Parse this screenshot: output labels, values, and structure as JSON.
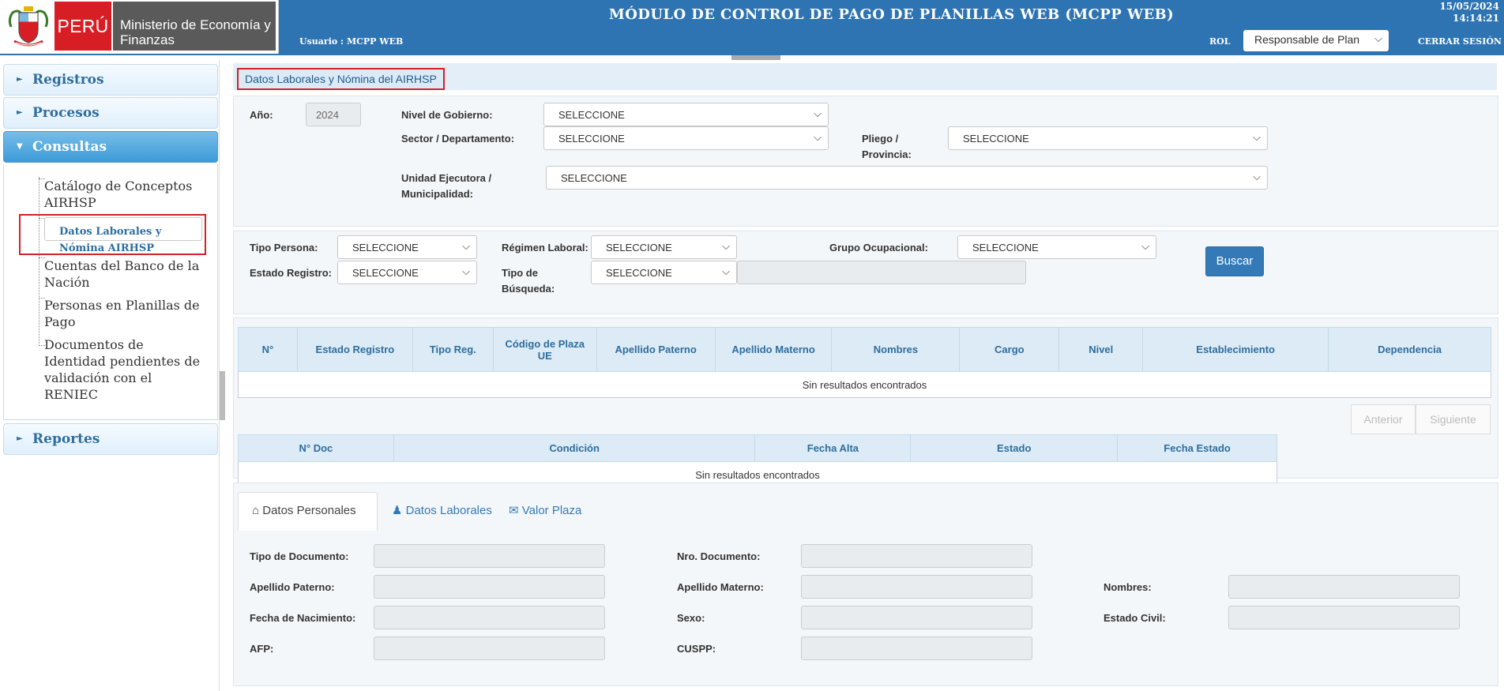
{
  "header": {
    "country": "PERÚ",
    "ministry": "Ministerio de Economía y Finanzas",
    "title": "MÓDULO DE CONTROL DE PAGO DE PLANILLAS WEB (MCPP WEB)",
    "date": "15/05/2024",
    "time": "14:14:21",
    "user_label": "Usuario : MCPP WEB",
    "rol_label": "ROL",
    "rol_value": "Responsable de Plan",
    "logout": "CERRAR SESIÓN"
  },
  "sidebar": {
    "sections": [
      {
        "label": "Registros"
      },
      {
        "label": "Procesos"
      },
      {
        "label": "Consultas"
      },
      {
        "label": "Reportes"
      }
    ],
    "consultas_items": [
      {
        "label": "Catálogo de Conceptos AIRHSP"
      },
      {
        "label": "Datos Laborales y Nómina AIRHSP"
      },
      {
        "label": "Cuentas del Banco de la Nación"
      },
      {
        "label": "Personas en Planillas de Pago"
      },
      {
        "label": "Documentos de Identidad pendientes de validación con el RENIEC"
      }
    ]
  },
  "page": {
    "title": "Datos Laborales y Nómina del AIRHSP"
  },
  "filters1": {
    "anio_label": "Año:",
    "anio_value": "2024",
    "nivel_label": "Nivel de Gobierno:",
    "nivel_value": "SELECCIONE",
    "sector_label": "Sector / Departamento:",
    "sector_value": "SELECCIONE",
    "pliego_label": "Pliego / Provincia:",
    "pliego_value": "SELECCIONE",
    "unidad_label": "Unidad Ejecutora / Municipalidad:",
    "unidad_value": "SELECCIONE"
  },
  "filters2": {
    "tipo_persona_label": "Tipo Persona:",
    "tipo_persona_value": "SELECCIONE",
    "regimen_label": "Régimen Laboral:",
    "regimen_value": "SELECCIONE",
    "grupo_label": "Grupo Ocupacional:",
    "grupo_value": "SELECCIONE",
    "estado_label": "Estado Registro:",
    "estado_value": "SELECCIONE",
    "tipo_busqueda_label": "Tipo de Búsqueda:",
    "tipo_busqueda_value": "SELECCIONE",
    "buscar": "Buscar"
  },
  "table1": {
    "headers": [
      "N°",
      "Estado Registro",
      "Tipo Reg.",
      "Código de Plaza UE",
      "Apellido Paterno",
      "Apellido Materno",
      "Nombres",
      "Cargo",
      "Nivel",
      "Establecimiento",
      "Dependencia"
    ],
    "empty": "Sin resultados encontrados"
  },
  "pager": {
    "prev": "Anterior",
    "next": "Siguiente"
  },
  "table2": {
    "headers": [
      "N° Doc",
      "Condición",
      "Fecha Alta",
      "Estado",
      "Fecha Estado"
    ],
    "empty": "Sin resultados encontrados"
  },
  "tabs": [
    {
      "label": "Datos Personales"
    },
    {
      "label": "Datos Laborales"
    },
    {
      "label": "Valor Plaza"
    }
  ],
  "personal": {
    "tipo_doc": "Tipo de Documento:",
    "nro_doc": "Nro. Documento:",
    "ap_paterno": "Apellido Paterno:",
    "ap_materno": "Apellido Materno:",
    "nombres": "Nombres:",
    "fecha_nac": "Fecha de Nacimiento:",
    "sexo": "Sexo:",
    "estado_civil": "Estado Civil:",
    "afp": "AFP:",
    "cuspp": "CUSPP:"
  }
}
